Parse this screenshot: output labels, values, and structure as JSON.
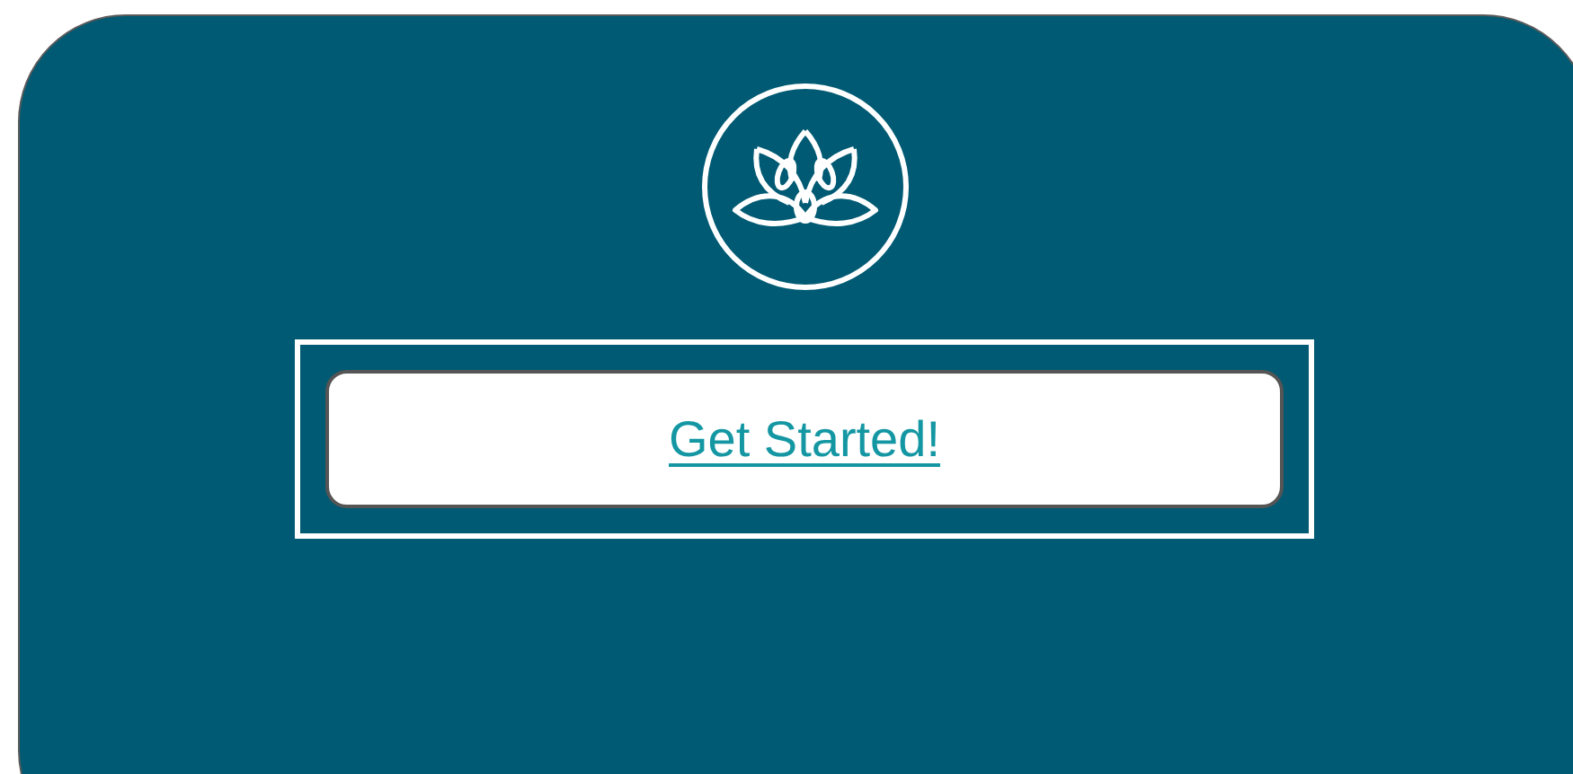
{
  "button": {
    "label": "Get Started!",
    "focused": true
  }
}
